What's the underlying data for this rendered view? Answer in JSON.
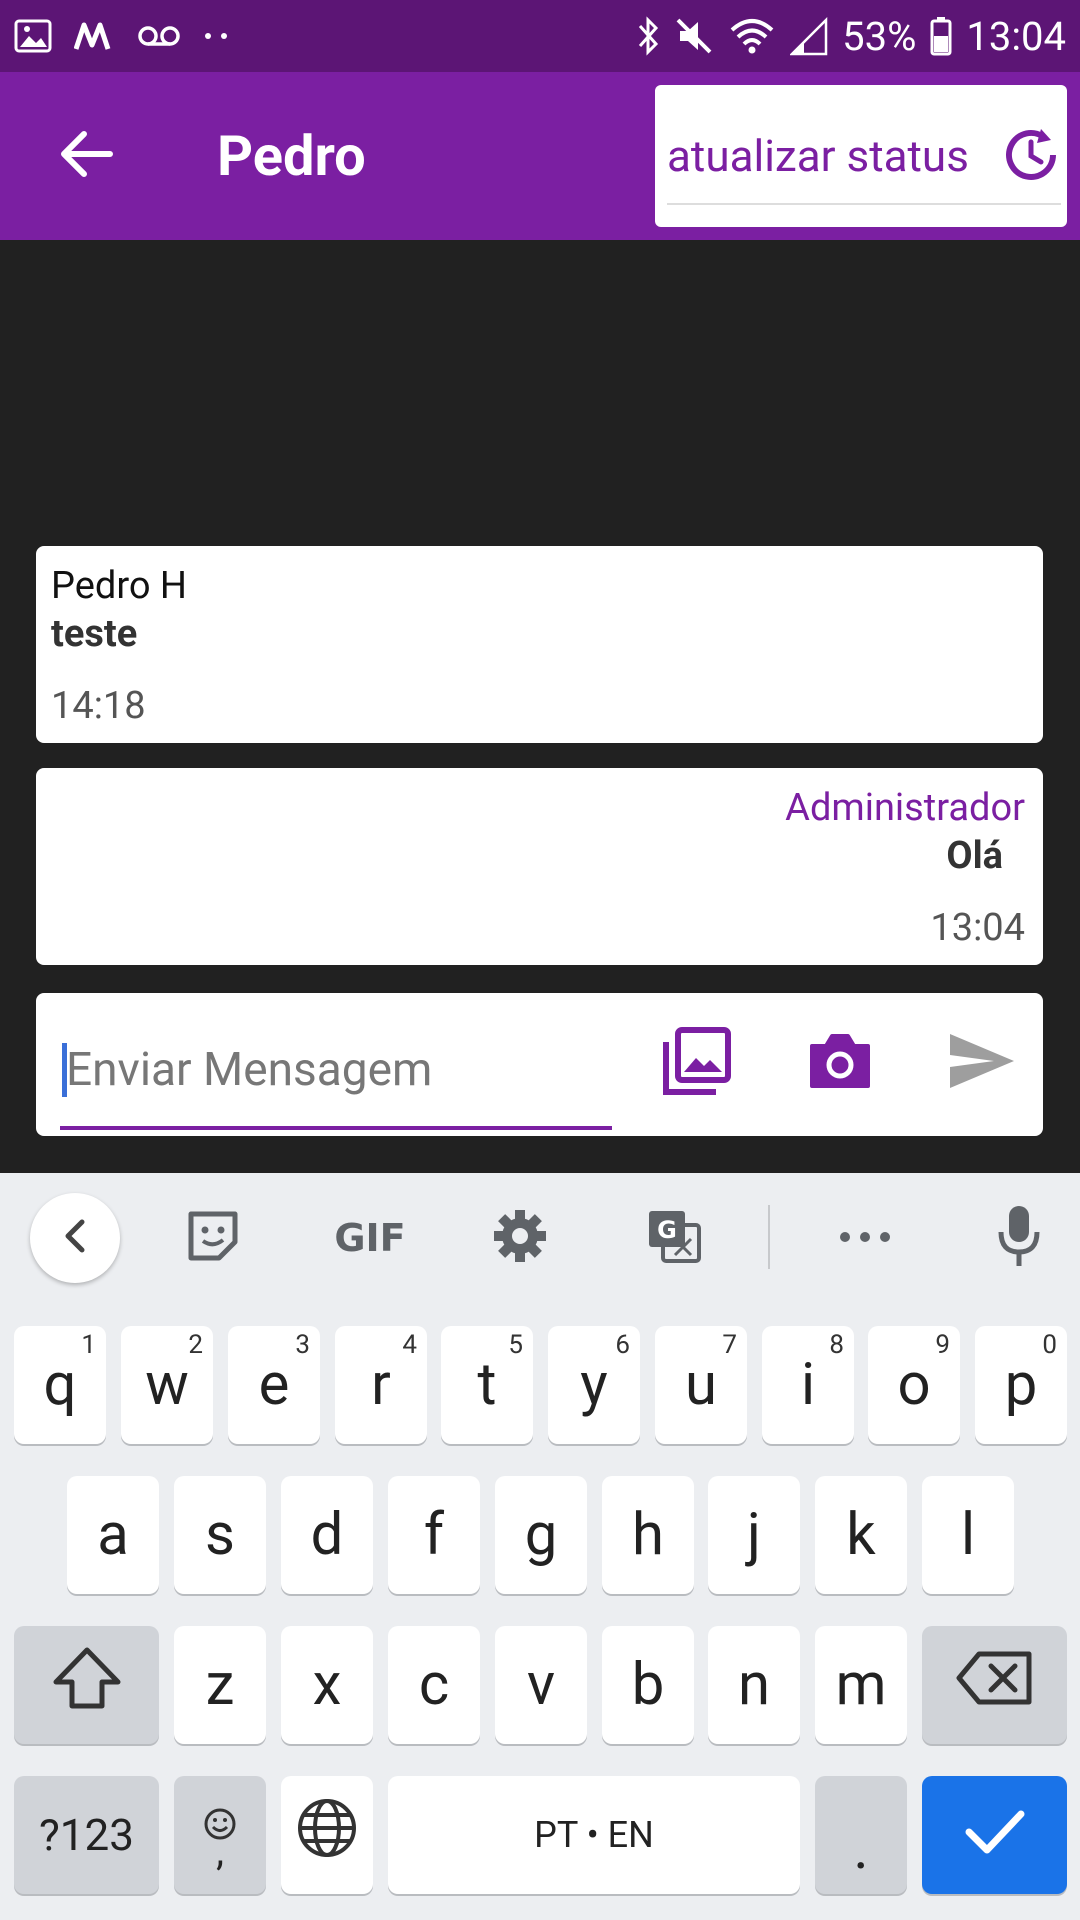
{
  "status_bar": {
    "battery": "53%",
    "time": "13:04",
    "icons": [
      "image-icon",
      "m-icon",
      "voicemail-icon",
      "dots-icon",
      "bluetooth-icon",
      "mute-icon",
      "wifi-icon",
      "signal-icon",
      "battery-icon"
    ]
  },
  "app_bar": {
    "title": "Pedro",
    "status_button_label": "atualizar status"
  },
  "messages": [
    {
      "sender": "Pedro H",
      "text": "teste",
      "time": "14:18"
    },
    {
      "sender": "Administrador",
      "text": "Olá",
      "time": "13:04"
    }
  ],
  "composer": {
    "placeholder": "Enviar Mensagem",
    "value": ""
  },
  "keyboard": {
    "toolbar": [
      "back-icon",
      "sticker-icon",
      "GIF",
      "settings-icon",
      "translate-icon",
      "more-icon",
      "mic-icon"
    ],
    "gif_label": "GIF",
    "row1": [
      {
        "k": "q",
        "n": "1"
      },
      {
        "k": "w",
        "n": "2"
      },
      {
        "k": "e",
        "n": "3"
      },
      {
        "k": "r",
        "n": "4"
      },
      {
        "k": "t",
        "n": "5"
      },
      {
        "k": "y",
        "n": "6"
      },
      {
        "k": "u",
        "n": "7"
      },
      {
        "k": "i",
        "n": "8"
      },
      {
        "k": "o",
        "n": "9"
      },
      {
        "k": "p",
        "n": "0"
      }
    ],
    "row2": [
      "a",
      "s",
      "d",
      "f",
      "g",
      "h",
      "j",
      "k",
      "l"
    ],
    "row3": [
      "z",
      "x",
      "c",
      "v",
      "b",
      "n",
      "m"
    ],
    "symbols_label": "?123",
    "emoji_comma_label": ",",
    "space_label": "PT • EN",
    "period_label": ".",
    "colors": {
      "purple": "#7b1fa2",
      "status_purple": "#5c1575",
      "blue": "#1a73e8"
    }
  }
}
